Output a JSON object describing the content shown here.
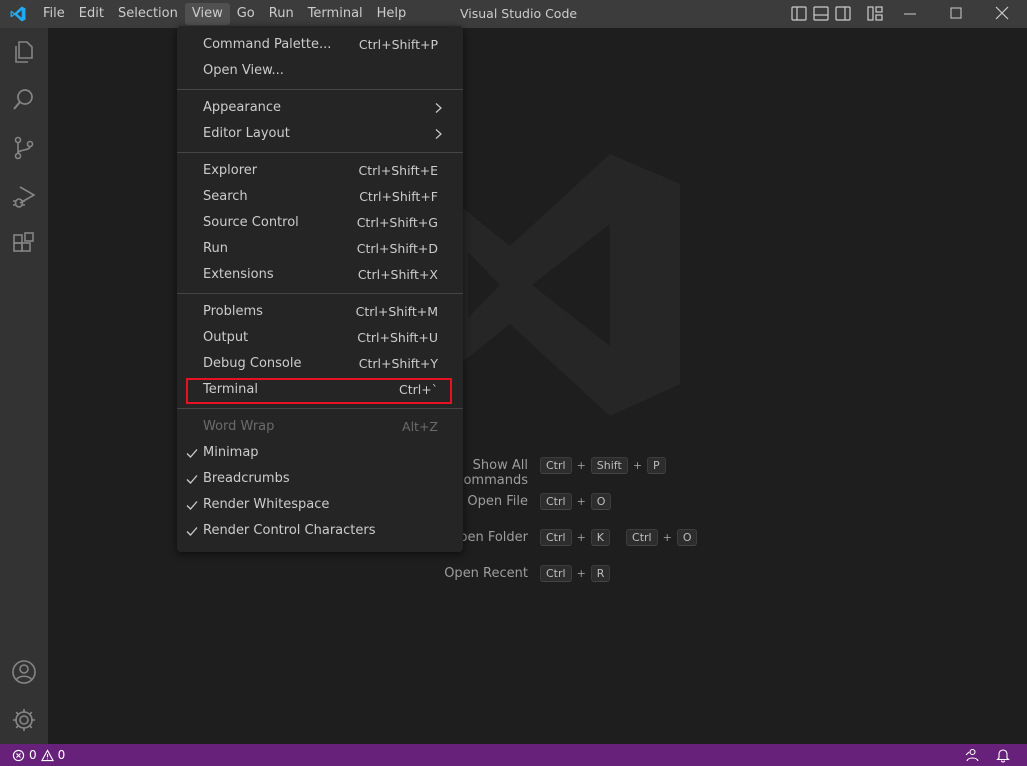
{
  "window": {
    "title": "Visual Studio Code"
  },
  "menubar": {
    "items": [
      "File",
      "Edit",
      "Selection",
      "View",
      "Go",
      "Run",
      "Terminal",
      "Help"
    ],
    "active": "View"
  },
  "view_menu": {
    "groups": [
      [
        {
          "label": "Command Palette...",
          "shortcut": "Ctrl+Shift+P"
        },
        {
          "label": "Open View...",
          "shortcut": ""
        }
      ],
      [
        {
          "label": "Appearance",
          "submenu": true
        },
        {
          "label": "Editor Layout",
          "submenu": true
        }
      ],
      [
        {
          "label": "Explorer",
          "shortcut": "Ctrl+Shift+E"
        },
        {
          "label": "Search",
          "shortcut": "Ctrl+Shift+F"
        },
        {
          "label": "Source Control",
          "shortcut": "Ctrl+Shift+G"
        },
        {
          "label": "Run",
          "shortcut": "Ctrl+Shift+D"
        },
        {
          "label": "Extensions",
          "shortcut": "Ctrl+Shift+X"
        }
      ],
      [
        {
          "label": "Problems",
          "shortcut": "Ctrl+Shift+M"
        },
        {
          "label": "Output",
          "shortcut": "Ctrl+Shift+U"
        },
        {
          "label": "Debug Console",
          "shortcut": "Ctrl+Shift+Y"
        },
        {
          "label": "Terminal",
          "shortcut": "Ctrl+`",
          "highlighted": true
        }
      ],
      [
        {
          "label": "Word Wrap",
          "shortcut": "Alt+Z",
          "disabled": true
        },
        {
          "label": "Minimap",
          "checked": true
        },
        {
          "label": "Breadcrumbs",
          "checked": true
        },
        {
          "label": "Render Whitespace",
          "checked": true
        },
        {
          "label": "Render Control Characters",
          "checked": true
        }
      ]
    ]
  },
  "welcome_hints": [
    {
      "label": "Show All Commands",
      "keys": [
        [
          "Ctrl",
          "Shift",
          "P"
        ]
      ]
    },
    {
      "label": "Open File",
      "keys": [
        [
          "Ctrl",
          "O"
        ]
      ]
    },
    {
      "label": "Open Folder",
      "keys": [
        [
          "Ctrl",
          "K"
        ],
        [
          "Ctrl",
          "O"
        ]
      ]
    },
    {
      "label": "Open Recent",
      "keys": [
        [
          "Ctrl",
          "R"
        ]
      ]
    }
  ],
  "statusbar": {
    "errors": "0",
    "warnings": "0"
  },
  "activity_bar": [
    "files-icon",
    "search-icon",
    "source-control-icon",
    "run-debug-icon",
    "extensions-icon",
    "account-icon",
    "manage-gear-icon"
  ],
  "colors": {
    "statusbar": "#68217a",
    "highlight_border": "#e81123"
  }
}
